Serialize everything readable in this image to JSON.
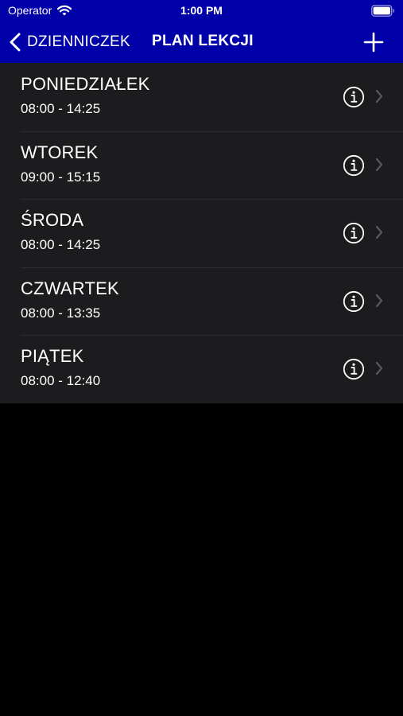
{
  "status_bar": {
    "carrier": "Operator",
    "time": "1:00 PM"
  },
  "nav": {
    "back_label": "DZIENNICZEK",
    "title": "PLAN LEKCJI",
    "add_icon": "plus-icon",
    "back_icon": "chevron-left-icon"
  },
  "colors": {
    "header": "#0000a8",
    "list_background": "#1c1c1e",
    "separator": "#2c2c2e",
    "page_background": "#000000",
    "disclosure": "#5a5a5e"
  },
  "days": [
    {
      "name": "PONIEDZIAŁEK",
      "hours": "08:00 - 14:25"
    },
    {
      "name": "WTOREK",
      "hours": "09:00 - 15:15"
    },
    {
      "name": "ŚRODA",
      "hours": "08:00 - 14:25"
    },
    {
      "name": "CZWARTEK",
      "hours": "08:00 - 13:35"
    },
    {
      "name": "PIĄTEK",
      "hours": "08:00 - 12:40"
    }
  ]
}
